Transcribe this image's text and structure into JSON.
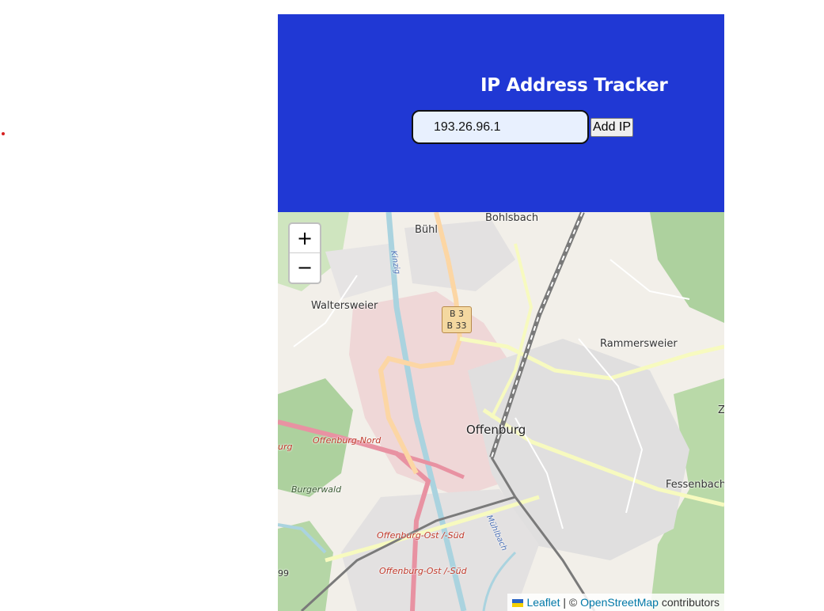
{
  "header": {
    "title": "IP Address Tracker",
    "background_color": "#2038d4"
  },
  "form": {
    "ip_value": "193.26.96.1",
    "add_button_label": "Add IP"
  },
  "map": {
    "zoom_in_label": "+",
    "zoom_out_label": "−",
    "labels": {
      "bohlsbach": "Bohlsbach",
      "buhl": "Bühl",
      "waltersweier": "Waltersweier",
      "rammersweier": "Rammersweier",
      "offenburg": "Offenburg",
      "offenburg_nord": "Offenburg-Nord",
      "urg": "urg",
      "burgerwald": "Burgerwald",
      "fessenbach": "Fessenbach",
      "offenburg_ost_1": "Offenburg-Ost /-Süd",
      "offenburg_ost_2": "Offenburg-Ost /-Süd",
      "kinzig": "Kinzig",
      "muhlbach": "Mühlbach",
      "ninety_nine": "99",
      "z": "Z",
      "b3": "B 3",
      "b33": "B 33"
    },
    "attribution": {
      "leaflet": "Leaflet",
      "separator": " | © ",
      "osm": "OpenStreetMap",
      "suffix": " contributors"
    }
  }
}
